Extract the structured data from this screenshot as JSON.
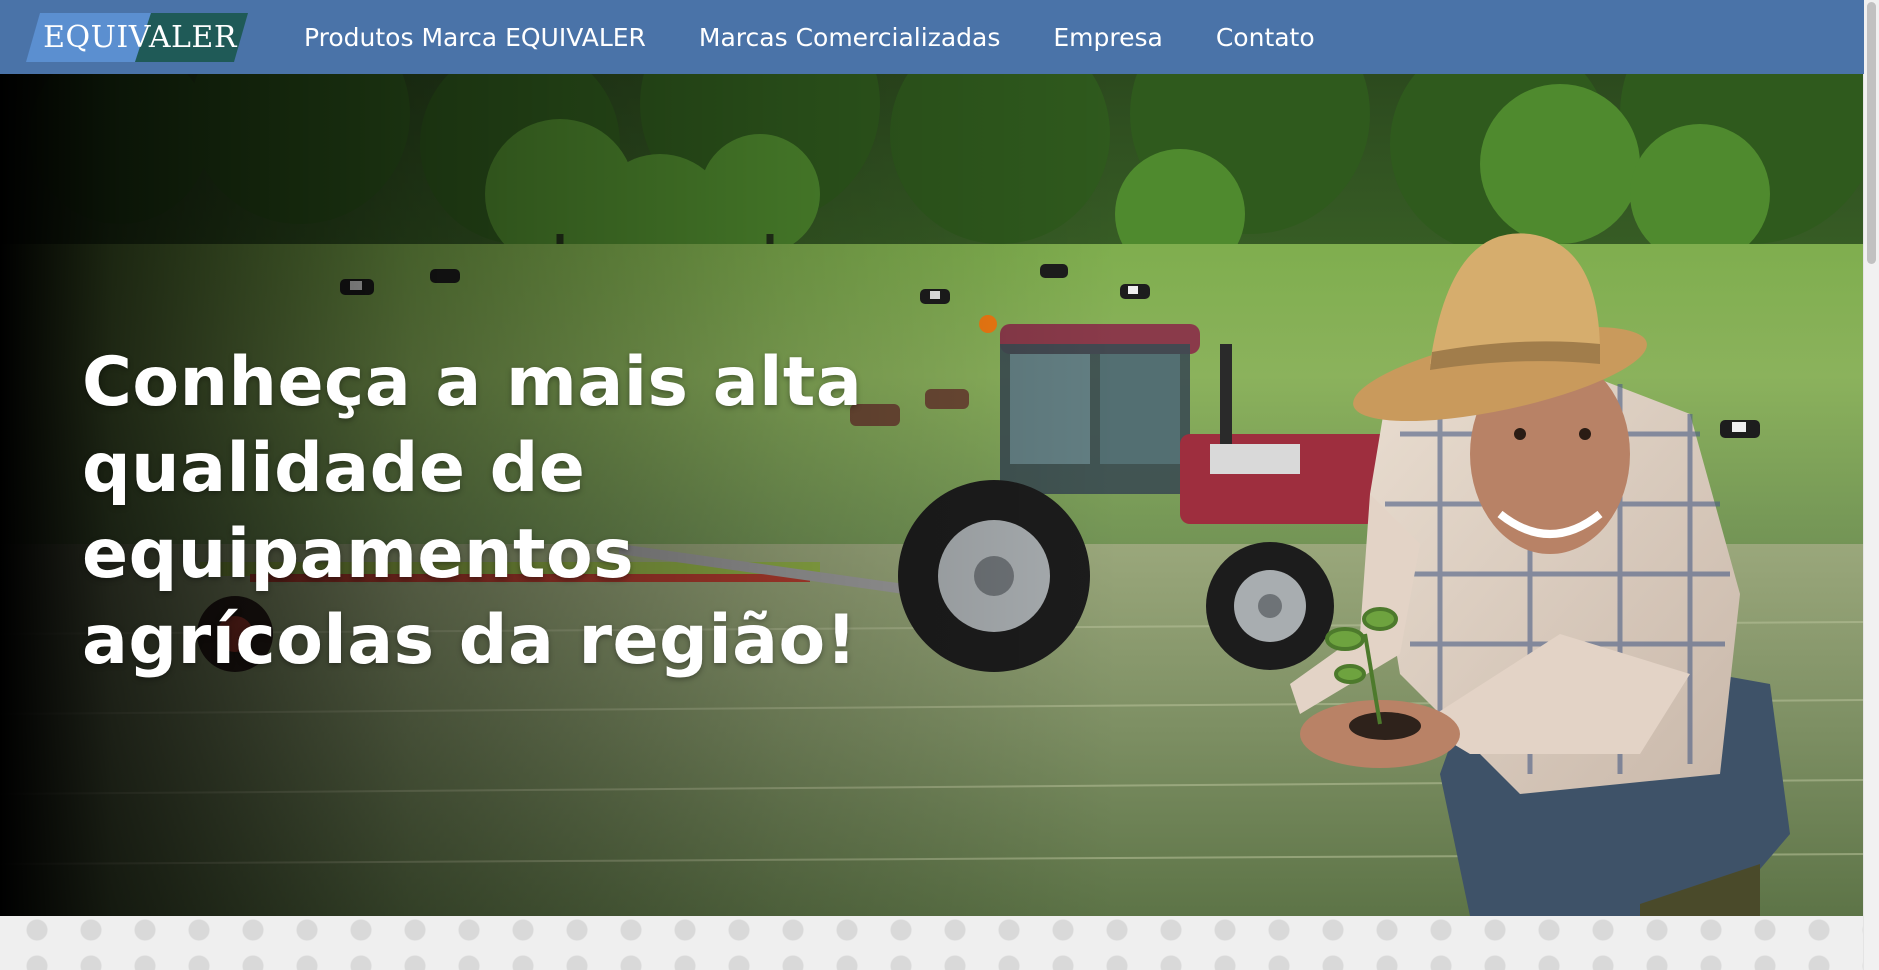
{
  "brand": {
    "logo_text": "EQUIVALER",
    "colors": {
      "header": "#4a73a8",
      "logo_light": "#5b8fd0",
      "logo_dark": "#1f5a57"
    }
  },
  "nav": {
    "items": [
      {
        "label": "Produtos Marca EQUIVALER"
      },
      {
        "label": "Marcas Comercializadas"
      },
      {
        "label": "Empresa"
      },
      {
        "label": "Contato"
      }
    ]
  },
  "hero": {
    "headline_lines": [
      "Conheça a mais alta",
      "qualidade de equipamentos",
      "agrícolas da região!"
    ]
  }
}
